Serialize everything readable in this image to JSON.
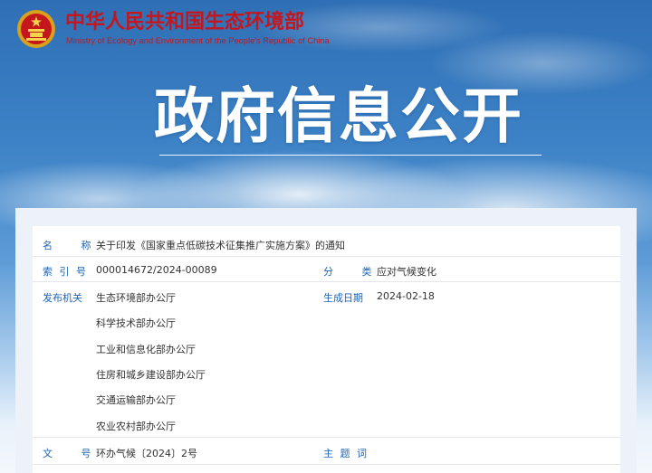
{
  "header": {
    "ministry_cn": "中华人民共和国生态环境部",
    "ministry_en": "Ministry of Ecology and Environment of the People's Republic of China",
    "emblem_icon": "national-emblem-icon",
    "brand_color": "#c4161c"
  },
  "hero": {
    "title": "政府信息公开"
  },
  "info": {
    "name_label": "名  称",
    "name_value": "关于印发《国家重点低碳技术征集推广实施方案》的通知",
    "index_label": "索 引 号",
    "index_value": "000014672/2024-00089",
    "category_label": "分  类",
    "category_value": "应对气候变化",
    "issuer_label": "发布机关",
    "issuers": [
      "生态环境部办公厅",
      "科学技术部办公厅",
      "工业和信息化部办公厅",
      "住房和城乡建设部办公厅",
      "交通运输部办公厅",
      "农业农村部办公厅"
    ],
    "date_label": "生成日期",
    "date_value": "2024-02-18",
    "doc_no_label": "文  号",
    "doc_no_value": "环办气候〔2024〕2号",
    "keywords_label": "主 题 词",
    "label_color": "#1e63b3"
  }
}
